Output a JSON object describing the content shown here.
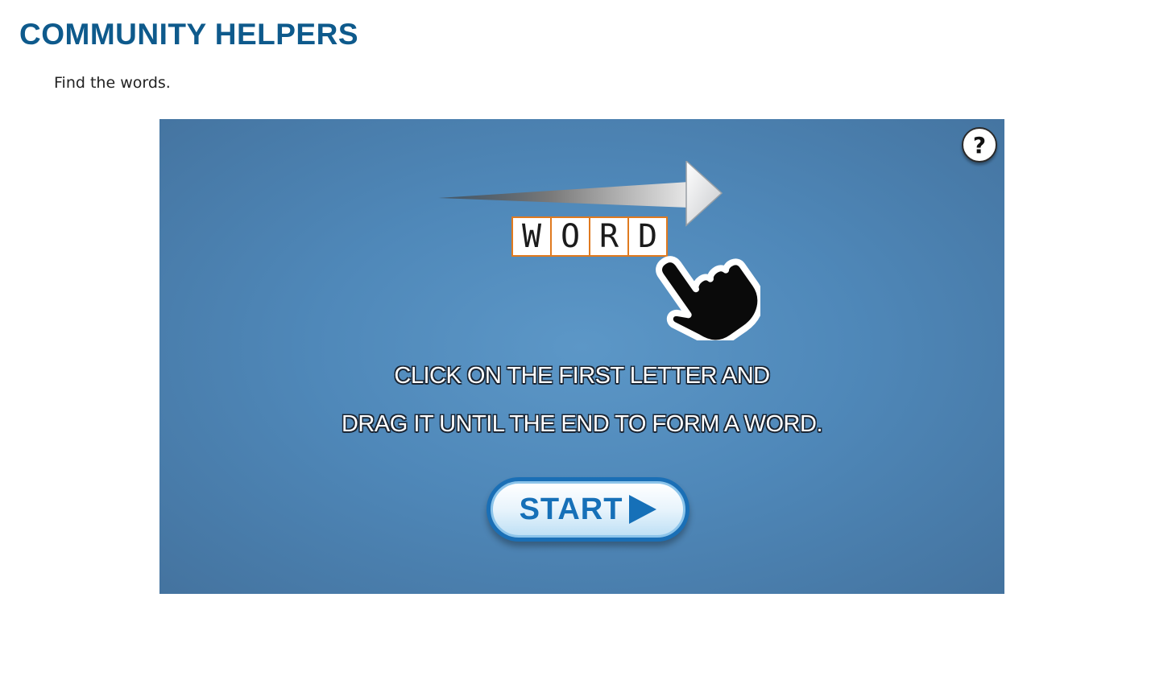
{
  "page": {
    "title": "COMMUNITY HELPERS",
    "instructions": "Find the words."
  },
  "game": {
    "help_label": "?",
    "demo_word": [
      "W",
      "O",
      "R",
      "D"
    ],
    "instruction_line_1": "CLICK ON THE FIRST LETTER AND",
    "instruction_line_2": "DRAG IT UNTIL THE END TO FORM A WORD.",
    "start_label": "START",
    "icons": [
      "help-icon",
      "arrow-right-icon",
      "pointing-hand-icon",
      "play-triangle-icon"
    ]
  },
  "colors": {
    "title": "#0e5a8c",
    "frame_bg": "#4f88b9",
    "letter_border": "#e07a1f",
    "start_text": "#1670b8"
  }
}
